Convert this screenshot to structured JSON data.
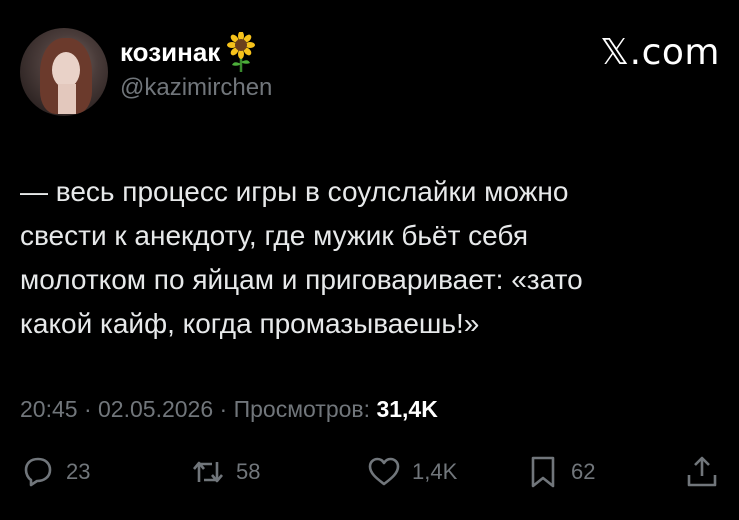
{
  "author": {
    "display_name": "козинак",
    "name_emoji": "sunflower-emoji",
    "handle": "@kazimirchen"
  },
  "brand": "𝕏.com",
  "tweet": {
    "lines": [
      "— весь процесс игры в соулслайки можно",
      "свести к анекдоту, где мужик бьёт себя",
      "молотком по яйцам и приговаривает: «зато",
      "какой кайф, когда промазываешь!»"
    ]
  },
  "meta": {
    "time": "20:45",
    "sep1": " · ",
    "date": "02.05.2026",
    "sep2": " · ",
    "views_label": "Просмотров: ",
    "views_count": "31,4K"
  },
  "actions": {
    "replies": "23",
    "reposts": "58",
    "likes": "1,4K",
    "bookmarks": "62"
  },
  "colors": {
    "background": "#000000",
    "text": "#e7e9ea",
    "muted": "#71767b"
  }
}
